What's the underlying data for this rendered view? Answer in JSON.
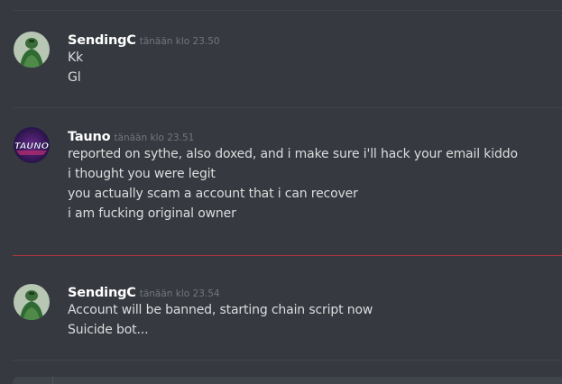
{
  "messages": [
    {
      "username": "SendingC",
      "timestamp": "tänään klo 23.50",
      "avatar": "green-figure-avatar",
      "lines": [
        "Kk",
        "Gl"
      ]
    },
    {
      "username": "Tauno",
      "timestamp": "tänään klo 23.51",
      "avatar": "tauno-logo-avatar",
      "avatar_text": "TAUNO",
      "lines": [
        "reported on sythe, also doxed, and i make sure i'll hack your email kiddo",
        "i thought you were legit",
        "you actually scam a account that i can recover",
        "i am fucking original owner"
      ]
    },
    {
      "username": "SendingC",
      "timestamp": "tänään klo 23.54",
      "avatar": "green-figure-avatar",
      "lines": [
        "Account will be banned, starting chain script now",
        "Suicide bot..."
      ]
    }
  ],
  "colors": {
    "background": "#36393f",
    "divider": "#41444a",
    "new_messages_divider": "#a8363b",
    "username": "#ffffff",
    "timestamp": "#72767d",
    "message_text": "#dcddde"
  }
}
